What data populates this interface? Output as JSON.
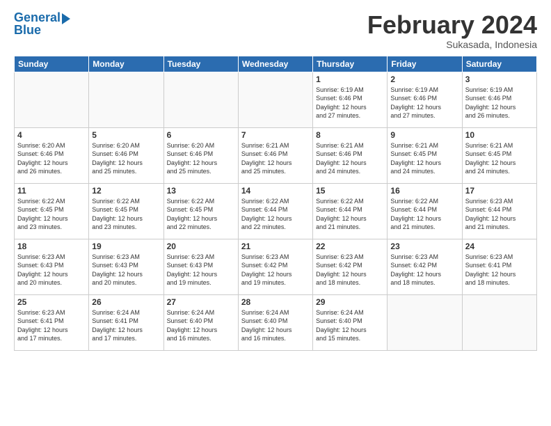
{
  "header": {
    "logo_line1": "General",
    "logo_line2": "Blue",
    "month_title": "February 2024",
    "subtitle": "Sukasada, Indonesia"
  },
  "columns": [
    "Sunday",
    "Monday",
    "Tuesday",
    "Wednesday",
    "Thursday",
    "Friday",
    "Saturday"
  ],
  "weeks": [
    [
      {
        "day": "",
        "info": ""
      },
      {
        "day": "",
        "info": ""
      },
      {
        "day": "",
        "info": ""
      },
      {
        "day": "",
        "info": ""
      },
      {
        "day": "1",
        "info": "Sunrise: 6:19 AM\nSunset: 6:46 PM\nDaylight: 12 hours\nand 27 minutes."
      },
      {
        "day": "2",
        "info": "Sunrise: 6:19 AM\nSunset: 6:46 PM\nDaylight: 12 hours\nand 27 minutes."
      },
      {
        "day": "3",
        "info": "Sunrise: 6:19 AM\nSunset: 6:46 PM\nDaylight: 12 hours\nand 26 minutes."
      }
    ],
    [
      {
        "day": "4",
        "info": "Sunrise: 6:20 AM\nSunset: 6:46 PM\nDaylight: 12 hours\nand 26 minutes."
      },
      {
        "day": "5",
        "info": "Sunrise: 6:20 AM\nSunset: 6:46 PM\nDaylight: 12 hours\nand 25 minutes."
      },
      {
        "day": "6",
        "info": "Sunrise: 6:20 AM\nSunset: 6:46 PM\nDaylight: 12 hours\nand 25 minutes."
      },
      {
        "day": "7",
        "info": "Sunrise: 6:21 AM\nSunset: 6:46 PM\nDaylight: 12 hours\nand 25 minutes."
      },
      {
        "day": "8",
        "info": "Sunrise: 6:21 AM\nSunset: 6:46 PM\nDaylight: 12 hours\nand 24 minutes."
      },
      {
        "day": "9",
        "info": "Sunrise: 6:21 AM\nSunset: 6:45 PM\nDaylight: 12 hours\nand 24 minutes."
      },
      {
        "day": "10",
        "info": "Sunrise: 6:21 AM\nSunset: 6:45 PM\nDaylight: 12 hours\nand 24 minutes."
      }
    ],
    [
      {
        "day": "11",
        "info": "Sunrise: 6:22 AM\nSunset: 6:45 PM\nDaylight: 12 hours\nand 23 minutes."
      },
      {
        "day": "12",
        "info": "Sunrise: 6:22 AM\nSunset: 6:45 PM\nDaylight: 12 hours\nand 23 minutes."
      },
      {
        "day": "13",
        "info": "Sunrise: 6:22 AM\nSunset: 6:45 PM\nDaylight: 12 hours\nand 22 minutes."
      },
      {
        "day": "14",
        "info": "Sunrise: 6:22 AM\nSunset: 6:44 PM\nDaylight: 12 hours\nand 22 minutes."
      },
      {
        "day": "15",
        "info": "Sunrise: 6:22 AM\nSunset: 6:44 PM\nDaylight: 12 hours\nand 21 minutes."
      },
      {
        "day": "16",
        "info": "Sunrise: 6:22 AM\nSunset: 6:44 PM\nDaylight: 12 hours\nand 21 minutes."
      },
      {
        "day": "17",
        "info": "Sunrise: 6:23 AM\nSunset: 6:44 PM\nDaylight: 12 hours\nand 21 minutes."
      }
    ],
    [
      {
        "day": "18",
        "info": "Sunrise: 6:23 AM\nSunset: 6:43 PM\nDaylight: 12 hours\nand 20 minutes."
      },
      {
        "day": "19",
        "info": "Sunrise: 6:23 AM\nSunset: 6:43 PM\nDaylight: 12 hours\nand 20 minutes."
      },
      {
        "day": "20",
        "info": "Sunrise: 6:23 AM\nSunset: 6:43 PM\nDaylight: 12 hours\nand 19 minutes."
      },
      {
        "day": "21",
        "info": "Sunrise: 6:23 AM\nSunset: 6:42 PM\nDaylight: 12 hours\nand 19 minutes."
      },
      {
        "day": "22",
        "info": "Sunrise: 6:23 AM\nSunset: 6:42 PM\nDaylight: 12 hours\nand 18 minutes."
      },
      {
        "day": "23",
        "info": "Sunrise: 6:23 AM\nSunset: 6:42 PM\nDaylight: 12 hours\nand 18 minutes."
      },
      {
        "day": "24",
        "info": "Sunrise: 6:23 AM\nSunset: 6:41 PM\nDaylight: 12 hours\nand 18 minutes."
      }
    ],
    [
      {
        "day": "25",
        "info": "Sunrise: 6:23 AM\nSunset: 6:41 PM\nDaylight: 12 hours\nand 17 minutes."
      },
      {
        "day": "26",
        "info": "Sunrise: 6:24 AM\nSunset: 6:41 PM\nDaylight: 12 hours\nand 17 minutes."
      },
      {
        "day": "27",
        "info": "Sunrise: 6:24 AM\nSunset: 6:40 PM\nDaylight: 12 hours\nand 16 minutes."
      },
      {
        "day": "28",
        "info": "Sunrise: 6:24 AM\nSunset: 6:40 PM\nDaylight: 12 hours\nand 16 minutes."
      },
      {
        "day": "29",
        "info": "Sunrise: 6:24 AM\nSunset: 6:40 PM\nDaylight: 12 hours\nand 15 minutes."
      },
      {
        "day": "",
        "info": ""
      },
      {
        "day": "",
        "info": ""
      }
    ]
  ]
}
